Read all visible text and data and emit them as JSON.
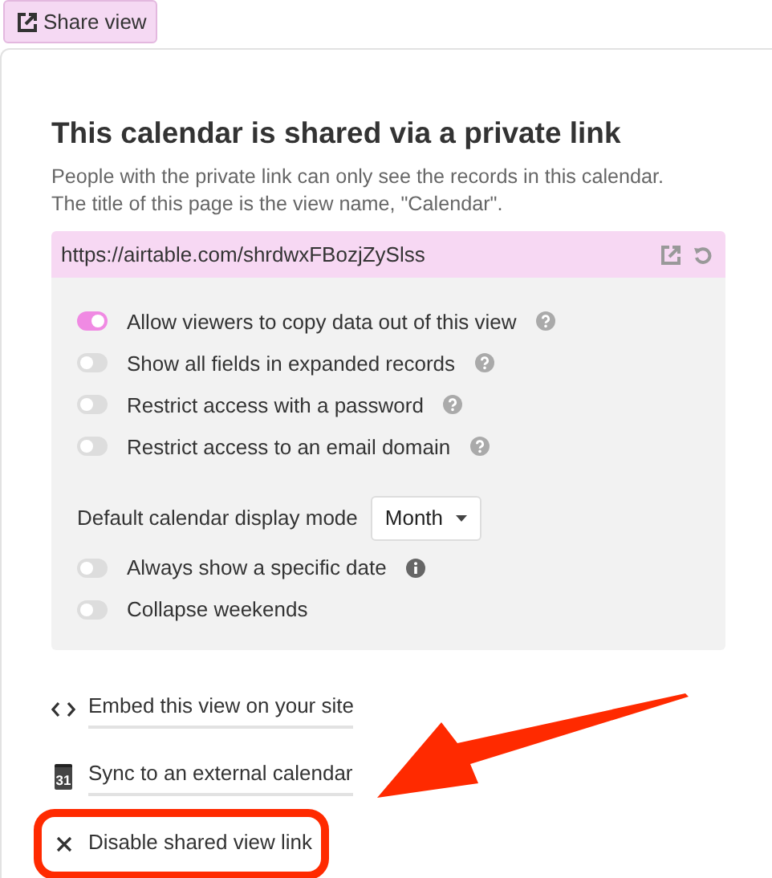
{
  "share_button": {
    "label": "Share view"
  },
  "title": "This calendar is shared via a private link",
  "description": "People with the private link can only see the records in this calendar. The title of this page is the view name, \"Calendar\".",
  "link": {
    "url": "https://airtable.com/shrdwxFBozjZySlss"
  },
  "options": [
    {
      "kind": "toggle",
      "label": "Allow viewers to copy data out of this view",
      "on": true,
      "help": true
    },
    {
      "kind": "toggle",
      "label": "Show all fields in expanded records",
      "on": false,
      "help": true
    },
    {
      "kind": "toggle",
      "label": "Restrict access with a password",
      "on": false,
      "help": true
    },
    {
      "kind": "toggle",
      "label": "Restrict access to an email domain",
      "on": false,
      "help": true
    },
    {
      "kind": "select",
      "label": "Default calendar display mode",
      "value": "Month"
    },
    {
      "kind": "toggle",
      "label": "Always show a specific date",
      "on": false,
      "info": true
    },
    {
      "kind": "toggle",
      "label": "Collapse weekends",
      "on": false
    }
  ],
  "actions": [
    {
      "kind": "embed",
      "label": "Embed this view on your site",
      "underlined": true,
      "highlighted": false
    },
    {
      "kind": "calendar",
      "icon_label": "31",
      "label": "Sync to an external calendar",
      "underlined": true,
      "highlighted": false
    },
    {
      "kind": "close",
      "label": "Disable shared view link",
      "underlined": false,
      "highlighted": true
    }
  ]
}
